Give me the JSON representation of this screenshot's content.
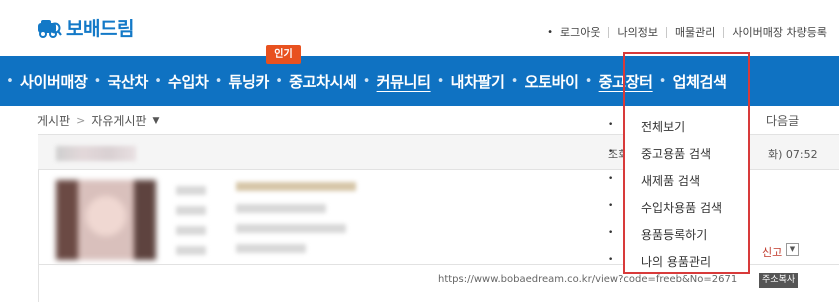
{
  "logo": {
    "text": "보배드림",
    "color": "#1379c7"
  },
  "top_links": [
    "로그아웃",
    "나의정보",
    "매물관리",
    "사이버매장 차량등록"
  ],
  "nav": {
    "items": [
      "사이버매장",
      "국산차",
      "수입차",
      "튜닝카",
      "중고차시세",
      "커뮤니티",
      "내차팔기",
      "오토바이",
      "중고장터",
      "업체검색"
    ],
    "hot_badge": "인기",
    "background": "#0f72c2"
  },
  "breadcrumb": {
    "root": "게시판",
    "current": "자유게시판"
  },
  "next_link": "다음글",
  "post": {
    "time": "화) 07:52",
    "side_text": "조회",
    "report": "신고",
    "url": "https://www.bobaedream.co.kr/view?code=freeb&No=2671",
    "copy_label": "주소복사"
  },
  "dropdown": {
    "items": [
      "전체보기",
      "중고용품 검색",
      "새제품 검색",
      "수입차용품 검색",
      "용품등록하기",
      "나의 용품관리"
    ]
  },
  "colors": {
    "highlight": "#d83a3a",
    "badge": "#e8511f"
  }
}
